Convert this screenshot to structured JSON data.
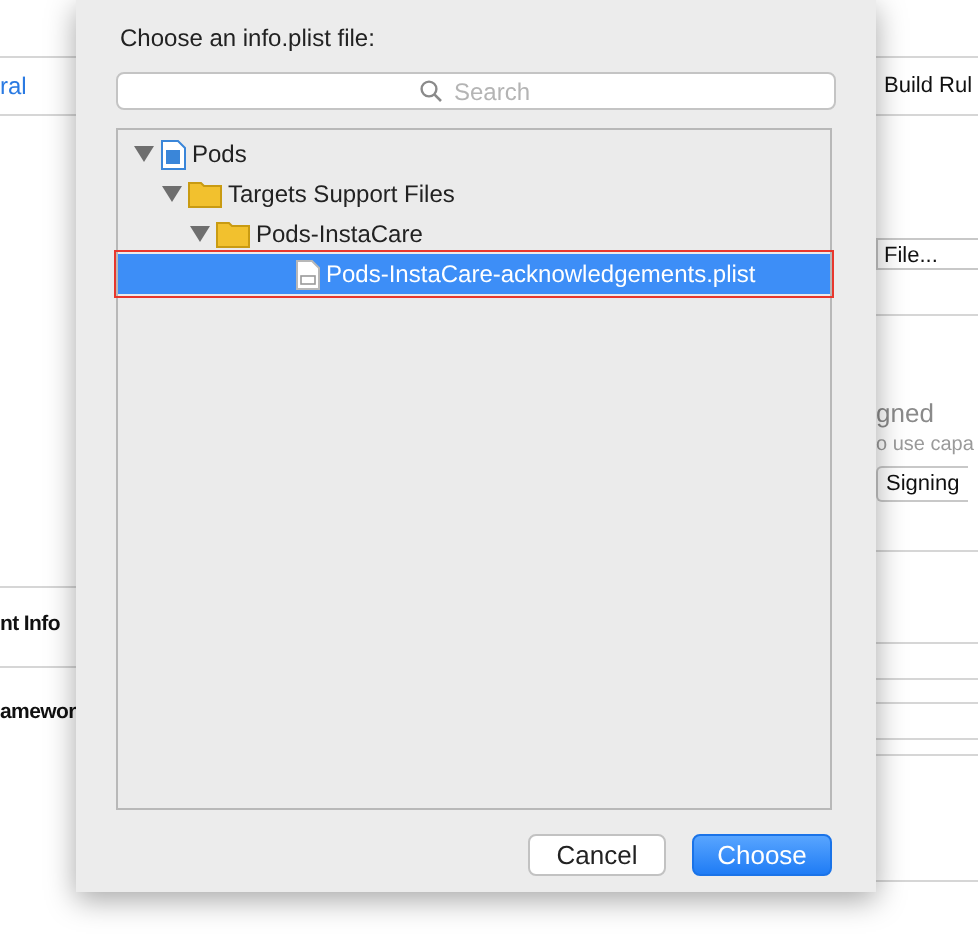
{
  "background": {
    "left_texts": [
      {
        "text": "ral",
        "kind": "link"
      },
      {
        "text": "nt Info",
        "kind": "heading"
      },
      {
        "text": "amewor",
        "kind": "heading"
      }
    ],
    "right_texts": [
      {
        "text": "Build Rul",
        "kind": "tab"
      },
      {
        "text": "File...",
        "kind": "field"
      },
      {
        "text": "gned",
        "kind": "note-title"
      },
      {
        "text": "o use capa",
        "kind": "note"
      },
      {
        "text": "Signing",
        "kind": "button"
      }
    ]
  },
  "sheet": {
    "title": "Choose an info.plist file:",
    "search": {
      "placeholder": "Search"
    },
    "tree": [
      {
        "label": "Pods",
        "kind": "project",
        "expanded": true,
        "selected": false,
        "children": [
          {
            "label": "Targets Support Files",
            "kind": "folder",
            "expanded": true,
            "selected": false,
            "children": [
              {
                "label": "Pods-InstaCare",
                "kind": "folder",
                "expanded": true,
                "selected": false,
                "children": [
                  {
                    "label": "Pods-InstaCare-acknowledgements.plist",
                    "kind": "file",
                    "selected": true,
                    "highlighted": true
                  }
                ]
              }
            ]
          }
        ]
      }
    ],
    "buttons": [
      {
        "label": "Cancel",
        "kind": "secondary"
      },
      {
        "label": "Choose",
        "kind": "primary"
      }
    ]
  }
}
